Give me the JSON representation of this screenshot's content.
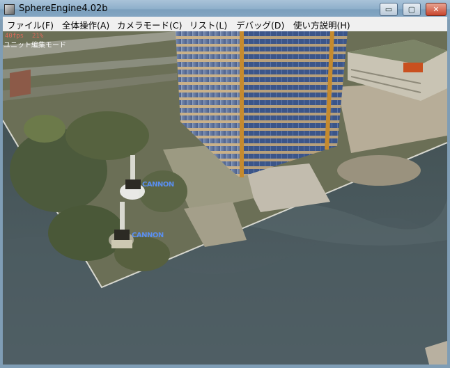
{
  "window": {
    "title": "SphereEngine4.02b"
  },
  "title_buttons": {
    "minimize": "▭",
    "maximize": "▢",
    "close": "✕"
  },
  "menu": [
    {
      "label": "ファイル(F)"
    },
    {
      "label": "全体操作(A)"
    },
    {
      "label": "カメラモード(C)"
    },
    {
      "label": "リスト(L)"
    },
    {
      "label": "デバッグ(D)"
    },
    {
      "label": "使い方説明(H)"
    }
  ],
  "hud": {
    "fps": "40fps",
    "count": "21%",
    "mode": "ユニット編集モード"
  },
  "units": [
    {
      "label": "CANNON"
    },
    {
      "label": "CANNON"
    }
  ],
  "colors": {
    "menu_bg": "#f0f0f0",
    "unit_label": "#5a8ff0",
    "hud_stats": "#e06a5a"
  }
}
